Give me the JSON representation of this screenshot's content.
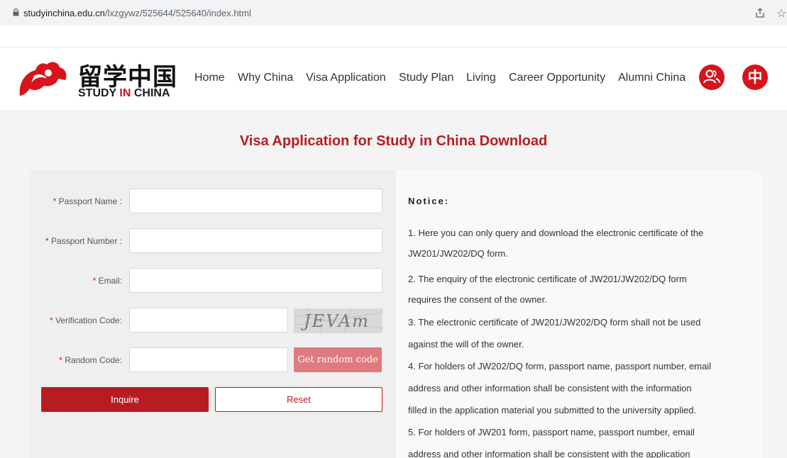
{
  "browser": {
    "url_domain": "studyinchina.edu.cn",
    "url_path": "/lxzgywz/525644/525640/index.html"
  },
  "header": {
    "logo_cn": "留学中国",
    "logo_en_1": "STUDY ",
    "logo_en_2": "IN",
    "logo_en_3": " CHINA",
    "nav": [
      "Home",
      "Why China",
      "Visa Application",
      "Study Plan",
      "Living",
      "Career Opportunity",
      "Alumni China"
    ],
    "lang_button": "中"
  },
  "page": {
    "title": "Visa Application for Study in China Download"
  },
  "form": {
    "required_mark": "*",
    "passport_name_label": " Passport Name :",
    "passport_number_label": " Passport Number :",
    "email_label": " Email:",
    "verification_code_label": " Verification Code:",
    "random_code_label": " Random Code:",
    "captcha_text": "JEVAm",
    "get_random_code": "Get random code",
    "inquire": "Inquire",
    "reset": "Reset"
  },
  "notice": {
    "title": "Notice:",
    "lines": [
      "1. Here you can only query and download the electronic certificate of the",
      "JW201/JW202/DQ form.",
      "2. The enquiry of the electronic certificate of JW201/JW202/DQ form",
      "requires the consent of the owner.",
      "3. The electronic certificate of JW201/JW202/DQ form shall not be used",
      "against the will of the owner.",
      "4. For holders of JW202/DQ form, passport name, passport number, email",
      "address and other information shall be consistent with the information",
      "filled in the application material you submitted to the university applied.",
      "5. For holders of JW201 form, passport name, passport number, email",
      "address and other information shall be consistent with the application"
    ]
  },
  "colors": {
    "brand_red": "#d7141c",
    "title_red": "#b81c22",
    "random_btn": "#df7a80"
  }
}
